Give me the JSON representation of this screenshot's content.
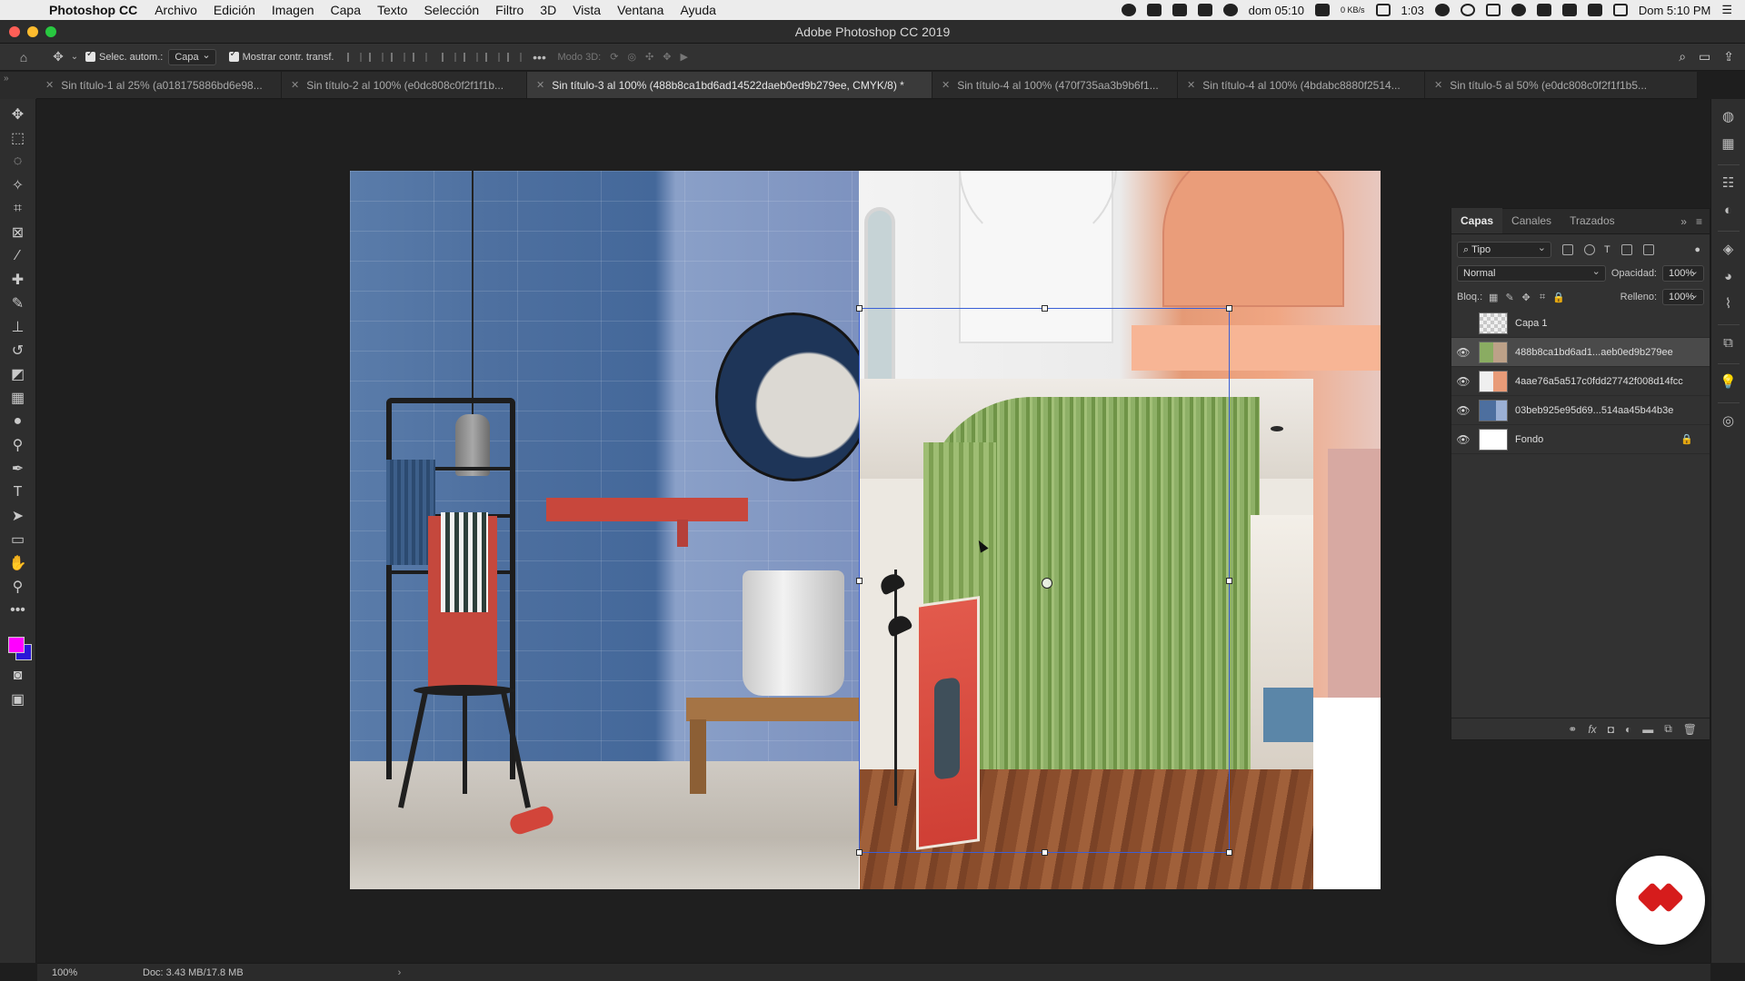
{
  "menubar": {
    "app_name": "Photoshop CC",
    "items": [
      "Archivo",
      "Edición",
      "Imagen",
      "Capa",
      "Texto",
      "Selección",
      "Filtro",
      "3D",
      "Vista",
      "Ventana",
      "Ayuda"
    ],
    "status_time": "dom 05:10",
    "network": "0 KB/s",
    "battery_time": "1:03",
    "clock": "Dom 5:10 PM"
  },
  "window": {
    "title": "Adobe Photoshop CC 2019"
  },
  "options": {
    "auto_select_label": "Selec. autom.:",
    "auto_select_value": "Capa",
    "show_transform_label": "Mostrar contr. transf.",
    "mode3d_label": "Modo 3D:"
  },
  "tabs": [
    {
      "label": "Sin título-1 al 25% (a018175886bd6e98...",
      "active": false
    },
    {
      "label": "Sin título-2 al 100% (e0dc808c0f2f1f1b...",
      "active": false
    },
    {
      "label": "Sin título-3 al 100% (488b8ca1bd6ad14522daeb0ed9b279ee, CMYK/8) *",
      "active": true
    },
    {
      "label": "Sin título-4 al 100% (470f735aa3b9b6f1...",
      "active": false
    },
    {
      "label": "Sin título-4 al 100% (4bdabc8880f2514...",
      "active": false
    },
    {
      "label": "Sin título-5 al 50% (e0dc808c0f2f1f1b5...",
      "active": false
    }
  ],
  "colors": {
    "foreground": "#ff00ff",
    "background": "#2a16d8"
  },
  "layers_panel": {
    "tabs": [
      "Capas",
      "Canales",
      "Trazados"
    ],
    "filter_label": "Tipo",
    "blend_mode": "Normal",
    "opacity_label": "Opacidad:",
    "opacity_value": "100%",
    "lock_label": "Bloq.:",
    "fill_label": "Relleno:",
    "fill_value": "100%",
    "layers": [
      {
        "name": "Capa 1",
        "visible": false,
        "thumb": "checker"
      },
      {
        "name": "488b8ca1bd6ad1...aeb0ed9b279ee",
        "visible": true,
        "thumb": "green",
        "selected": true
      },
      {
        "name": "4aae76a5a517c0fdd27742f008d14fcc",
        "visible": true,
        "thumb": "peach"
      },
      {
        "name": "03beb925e95d69...514aa45b44b3e",
        "visible": true,
        "thumb": "blue"
      },
      {
        "name": "Fondo",
        "visible": true,
        "thumb": "white",
        "locked": true
      }
    ]
  },
  "status": {
    "zoom": "100%",
    "doc_info": "Doc: 3.43 MB/17.8 MB"
  }
}
